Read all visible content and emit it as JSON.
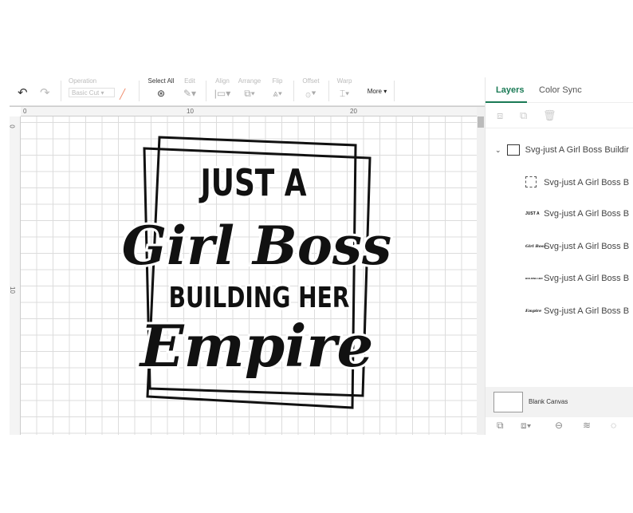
{
  "toolbar": {
    "undo_icon": "undo-icon",
    "redo_icon": "redo-icon",
    "operation_label": "Operation",
    "operation_value": "Basic Cut",
    "select_all": "Select All",
    "edit": "Edit",
    "align": "Align",
    "arrange": "Arrange",
    "flip": "Flip",
    "offset": "Offset",
    "warp": "Warp",
    "more": "More ▾"
  },
  "rulers": {
    "top": [
      "0",
      "10",
      "20"
    ],
    "left": [
      "0",
      "10"
    ]
  },
  "design": {
    "line1": "JUST A",
    "line2": "Girl Boss",
    "line3": "BUILDING HER",
    "line4": "Empire"
  },
  "panel": {
    "tabs": [
      "Layers",
      "Color Sync"
    ],
    "group": {
      "name": "Svg-just A Girl Boss Buildir"
    },
    "layers": [
      {
        "thumb": "",
        "name": "Svg-just A Girl Boss B"
      },
      {
        "thumb": "JUST A",
        "name": "Svg-just A Girl Boss B"
      },
      {
        "thumb": "Girl Boss",
        "name": "Svg-just A Girl Boss B"
      },
      {
        "thumb": "BUILDING HER",
        "name": "Svg-just A Girl Boss B"
      },
      {
        "thumb": "Empire",
        "name": "Svg-just A Girl Boss B"
      }
    ],
    "blank_canvas": "Blank Canvas"
  },
  "colors": {
    "accent": "#1a7a55",
    "blade": "#f08a6a"
  }
}
